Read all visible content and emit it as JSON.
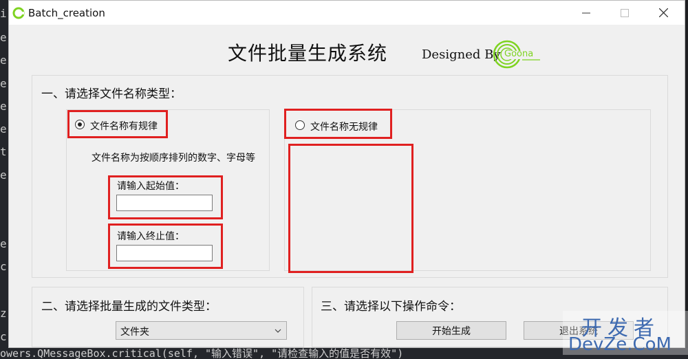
{
  "window": {
    "title": "Batch_creation"
  },
  "header": {
    "heading": "文件批量生成系统",
    "designed_by": "Designed By",
    "logo_text": "Goona"
  },
  "section1": {
    "title": "一、请选择文件名称类型：",
    "regular": {
      "label": "文件名称有规律",
      "selected": true,
      "description": "文件名称为按顺序排列的数字、字母等",
      "start_label": "请输入起始值：",
      "start_value": "",
      "end_label": "请输入终止值：",
      "end_value": ""
    },
    "irregular": {
      "label": "文件名称无规律",
      "selected": false
    }
  },
  "section2": {
    "title": "二、请选择批量生成的文件类型：",
    "selected_type": "文件夹"
  },
  "section3": {
    "title": "三、请选择以下操作命令：",
    "start_button": "开始生成",
    "exit_button": "退出系统"
  },
  "background": {
    "left_chars": [
      "i",
      "e",
      "e",
      "e",
      "e",
      "e",
      "t",
      "e",
      "e",
      "c",
      "z",
      "c"
    ],
    "bottom_code": "owers.QMessageBox.critical(self, \"输入错误\", \"请检查输入的值是否有效\")"
  },
  "watermark": {
    "line1": "开发者",
    "line2": "DevZe.CoM"
  },
  "colors": {
    "highlight": "#e02020",
    "logo": "#7ed321",
    "watermark": "#3e6ab0"
  }
}
